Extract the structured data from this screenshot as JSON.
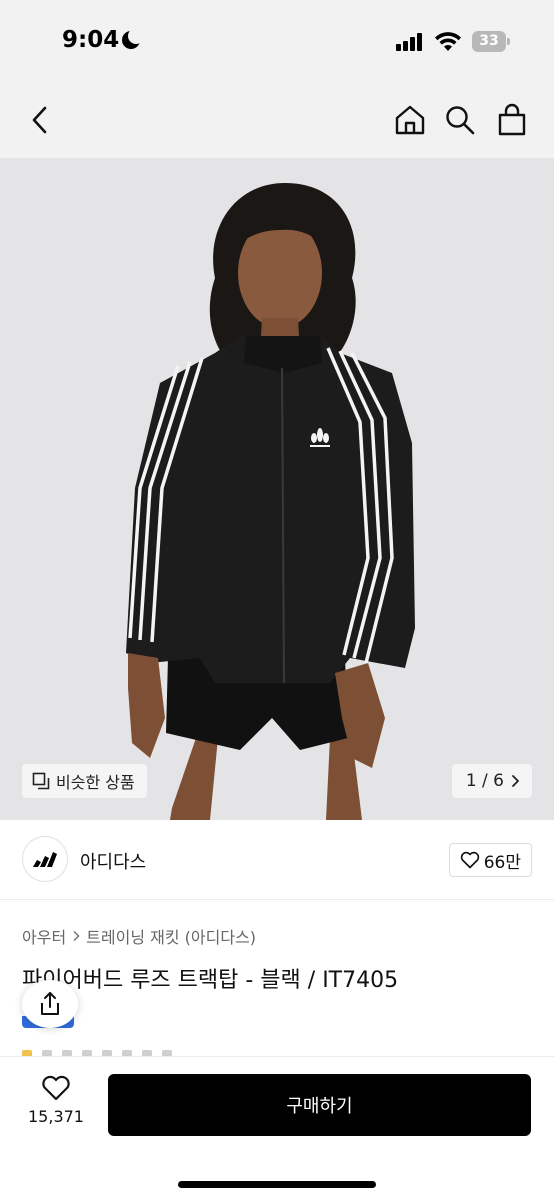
{
  "status_bar": {
    "time": "9:04",
    "battery": "33"
  },
  "nav": {
    "back_icon": "chevron-left-icon",
    "home_icon": "home-icon",
    "search_icon": "search-icon",
    "cart_icon": "shopping-bag-icon"
  },
  "gallery": {
    "similar_label": "비슷한 상품",
    "counter": "1 / 6"
  },
  "brand": {
    "name": "아디다스",
    "likes": "66만"
  },
  "product": {
    "breadcrumb": [
      "아우터",
      "트레이닝 재킷 (아디다스)"
    ],
    "title": "파이어버드 루즈 트랙탑 - 블랙 / IT7405"
  },
  "bottom_bar": {
    "wish_count": "15,371",
    "buy_label": "구매하기"
  },
  "colors": {
    "accent_blue": "#2f6ddb",
    "buy_button": "#000000",
    "header_bg": "#f2f2f2",
    "hero_bg": "#e4e4e6"
  }
}
